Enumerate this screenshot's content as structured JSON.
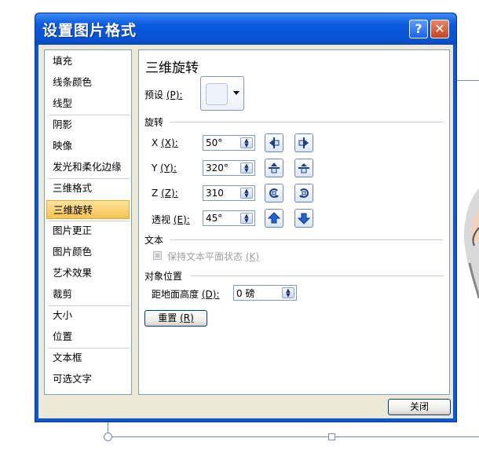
{
  "dialog": {
    "title": "设置图片格式",
    "help_glyph": "?",
    "close_glyph": "✕"
  },
  "nav": {
    "items": [
      {
        "label": "填充"
      },
      {
        "label": "线条颜色"
      },
      {
        "label": "线型"
      },
      {
        "label": "阴影"
      },
      {
        "label": "映像"
      },
      {
        "label": "发光和柔化边缘"
      },
      {
        "label": "三维格式"
      },
      {
        "label": "三维旋转",
        "selected": true
      },
      {
        "label": "图片更正"
      },
      {
        "label": "图片颜色"
      },
      {
        "label": "艺术效果"
      },
      {
        "label": "裁剪"
      },
      {
        "label": "大小"
      },
      {
        "label": "位置"
      },
      {
        "label": "文本框"
      },
      {
        "label": "可选文字"
      }
    ]
  },
  "panel": {
    "title": "三维旋转",
    "preset_label": "预设",
    "preset_key": "(P):",
    "rotation_heading": "旋转",
    "x": {
      "label": "X",
      "key": "(X):",
      "value": "50°"
    },
    "y": {
      "label": "Y",
      "key": "(Y):",
      "value": "320°"
    },
    "z": {
      "label": "Z",
      "key": "(Z):",
      "value": "310"
    },
    "perspective": {
      "label": "透视",
      "key": "(E):",
      "value": "45°"
    },
    "text_heading": "文本",
    "keep_flat_label": "保持文本平面状态",
    "keep_flat_key": "(K)",
    "object_position_heading": "对象位置",
    "distance_label": "距地面高度",
    "distance_key": "(D):",
    "distance_value": "0 磅",
    "reset_label": "重置",
    "reset_key": "(R)"
  },
  "footer": {
    "close_label": "关闭"
  },
  "icons": {
    "rotate_left": "rotate-left-icon",
    "rotate_right": "rotate-right-icon",
    "tilt_up": "tilt-up-icon",
    "tilt_down": "tilt-down-icon",
    "rotate_ccw": "rotate-ccw-icon",
    "rotate_cw": "rotate-cw-icon",
    "persp_increase": "perspective-increase-icon",
    "persp_decrease": "perspective-decrease-icon"
  },
  "colors": {
    "title_bar": "#0a57d8",
    "selected_item": "#f6c453",
    "dialog_body": "#ece9d8"
  }
}
